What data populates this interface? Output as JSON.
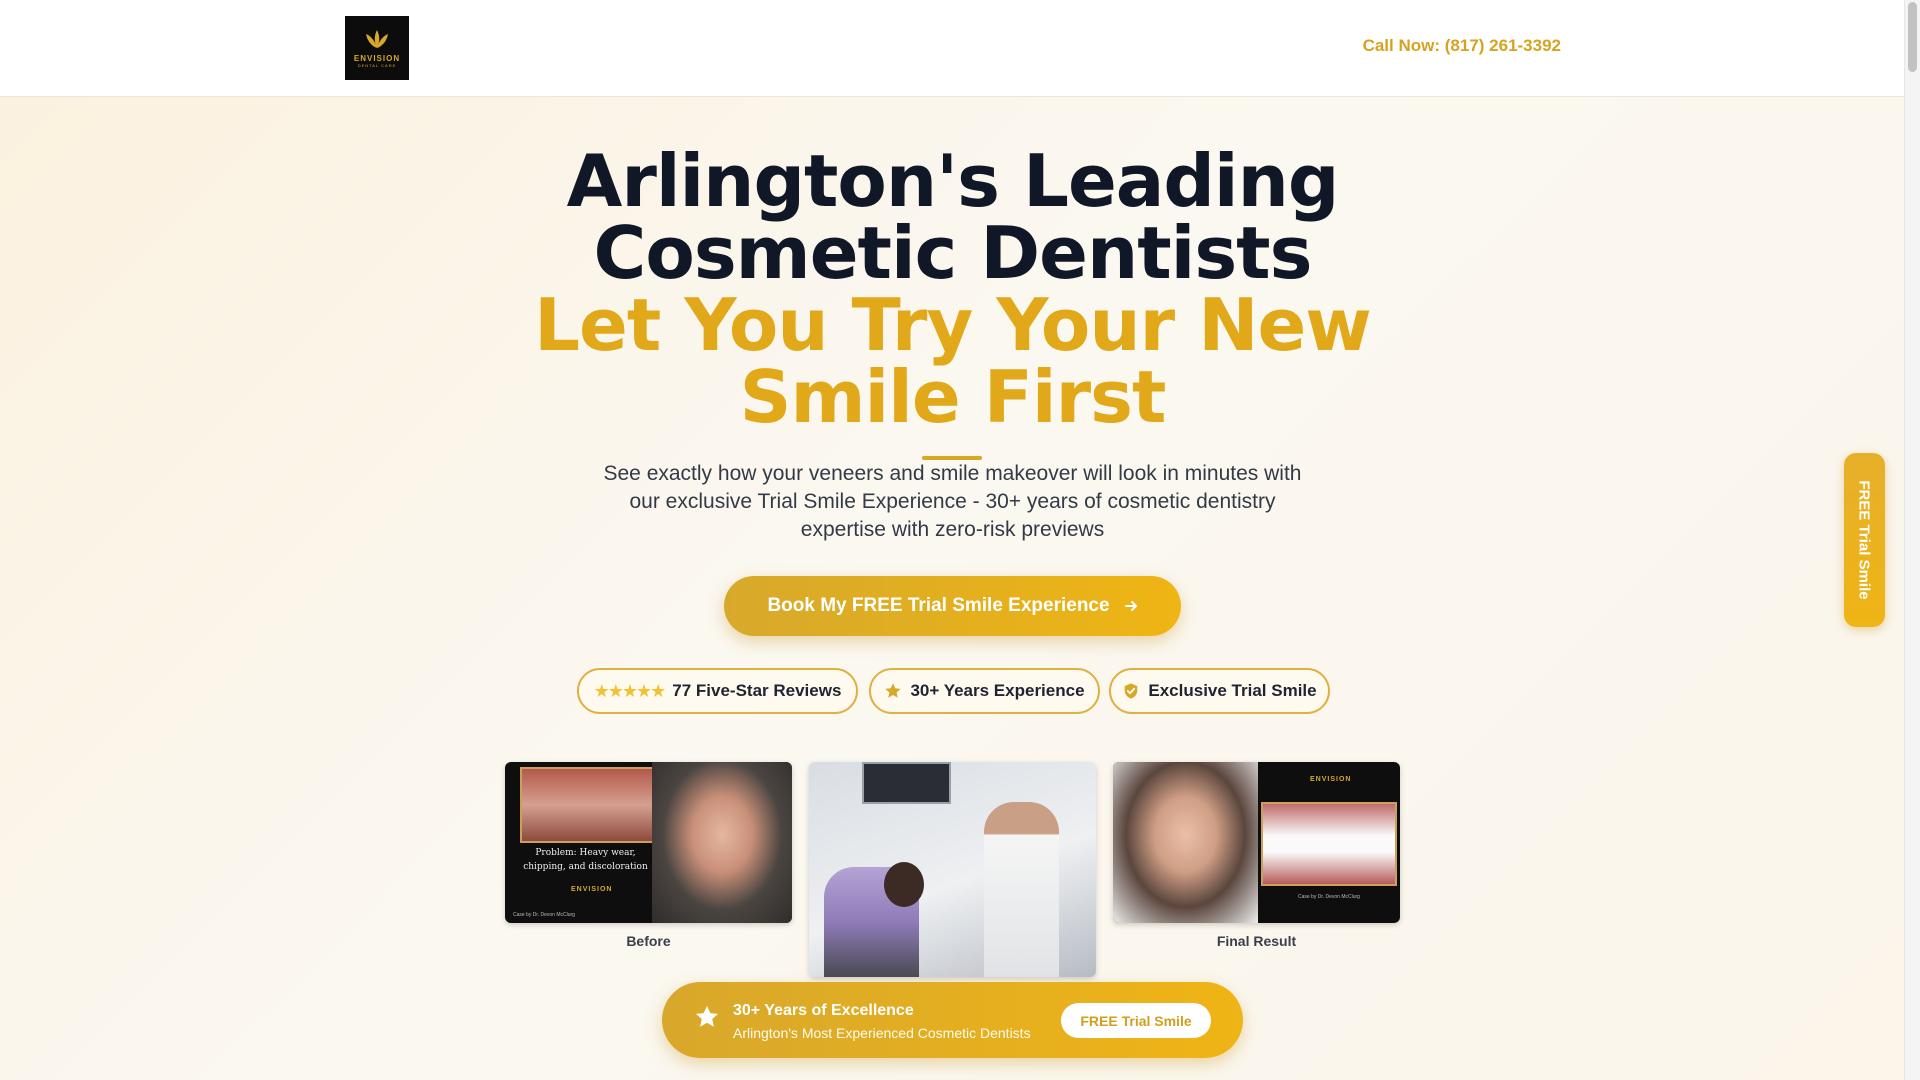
{
  "header": {
    "logo_text": "ENVISION",
    "logo_sub": "DENTAL CARE",
    "call": "Call Now: (817) 261-3392"
  },
  "hero": {
    "title_line1": "Arlington's Leading",
    "title_line2": "Cosmetic Dentists",
    "title_line3": "Let You Try Your New",
    "title_line4": "Smile First",
    "subtext": "See exactly how your veneers and smile makeover will look in minutes with our exclusive Trial Smile Experience - 30+ years of cosmetic dentistry expertise with zero-risk previews",
    "cta": "Book My FREE Trial Smile Experience",
    "cta_icon": "arrow-right-icon"
  },
  "badges": {
    "reviews_stars": "★★★★★",
    "reviews": "77 Five-Star Reviews",
    "experience": "30+ Years Experience",
    "exclusive": "Exclusive Trial Smile"
  },
  "gallery": {
    "before_problem": "Problem: Heavy wear, chipping, and discoloration",
    "before_logo": "ENVISION",
    "before_credit": "Case by Dr. Devon McClurg",
    "after_logo": "ENVISION",
    "after_credit": "Case by Dr. Devon McClurg",
    "caption_before": "Before",
    "caption_after": "Final Result"
  },
  "banner": {
    "title": "30+ Years of Excellence",
    "subtitle": "Arlington's Most Experienced Cosmetic Dentists",
    "button": "FREE Trial Smile"
  },
  "side_tab": {
    "label": "FREE Trial Smile"
  },
  "colors": {
    "accent": "#e1a81a",
    "dark_text": "#101828",
    "background": "#fbf6ec"
  }
}
